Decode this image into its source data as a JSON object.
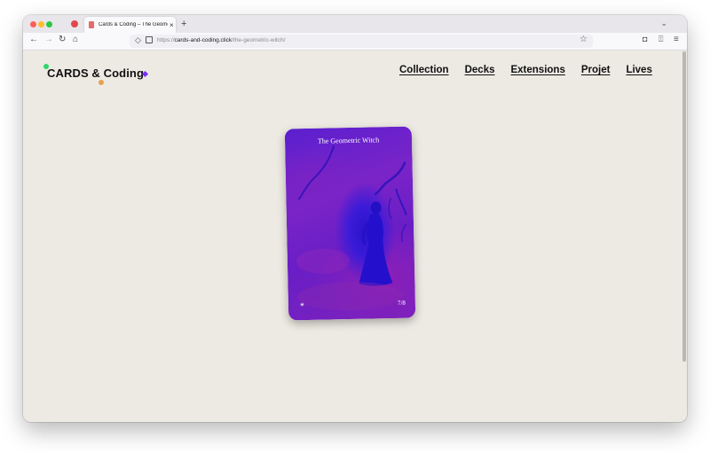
{
  "browser": {
    "tab_title": "Cards & Coding – The Geometric Witch",
    "tab_close": "×",
    "new_tab": "+",
    "url_scheme": "https://",
    "url_host": "cards-and-coding.click",
    "url_path": "/the-geometric-witch/",
    "icons": {
      "back": "←",
      "forward": "→",
      "reload": "↻",
      "home": "⌂",
      "shield": "◇",
      "star": "☆",
      "pocket": "◘",
      "extensions": "⍐",
      "menu": "≡",
      "tabs_overflow": "⌄"
    }
  },
  "site": {
    "logo": "CARDS & Coding",
    "nav": [
      "Collection",
      "Decks",
      "Extensions",
      "Projet",
      "Lives"
    ]
  },
  "card": {
    "title": "The Geometric Witch",
    "symbol": "*",
    "count": "7/8"
  },
  "colors": {
    "page_background": "#edeae3",
    "card_purple": "#7a24c8",
    "card_blue": "#2a12c9",
    "logo_green": "#2fd66b",
    "logo_orange": "#e7a052",
    "logo_violet": "#7b2ff7"
  }
}
